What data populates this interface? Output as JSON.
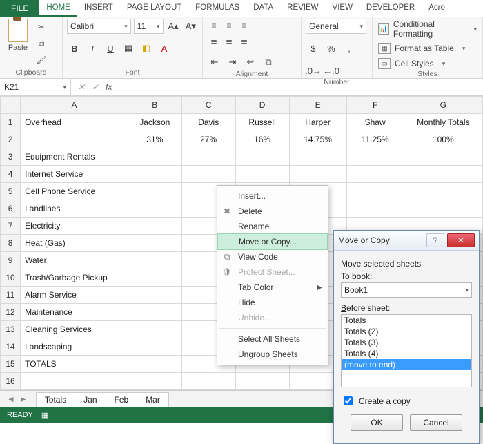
{
  "ribbon": {
    "file": "FILE",
    "tabs": [
      "HOME",
      "INSERT",
      "PAGE LAYOUT",
      "FORMULAS",
      "DATA",
      "REVIEW",
      "VIEW",
      "DEVELOPER",
      "Acro"
    ],
    "clipboard": {
      "paste": "Paste",
      "group": "Clipboard"
    },
    "font": {
      "name": "Calibri",
      "size": "11",
      "group": "Font"
    },
    "alignment": {
      "group": "Alignment"
    },
    "number": {
      "format": "General",
      "group": "Number"
    },
    "styles": {
      "cond": "Conditional Formatting",
      "table": "Format as Table",
      "cell": "Cell Styles",
      "group": "Styles"
    }
  },
  "formula_bar": {
    "name_box": "K21",
    "fx": "fx"
  },
  "columns": [
    "A",
    "B",
    "C",
    "D",
    "E",
    "F",
    "G"
  ],
  "headers": [
    "Overhead",
    "Jackson",
    "Davis",
    "Russell",
    "Harper",
    "Shaw",
    "Monthly Totals"
  ],
  "percent_row": [
    "",
    "31%",
    "27%",
    "16%",
    "14.75%",
    "11.25%",
    "100%"
  ],
  "items": [
    "Equipment Rentals",
    "Internet Service",
    "Cell Phone Service",
    "Landlines",
    "Electricity",
    "Heat (Gas)",
    "Water",
    "Trash/Garbage Pickup",
    "Alarm Service",
    "Maintenance",
    "Cleaning Services",
    "Landscaping"
  ],
  "totals_label": "TOTALS",
  "sheet_tabs": [
    "Totals",
    "Jan",
    "Feb",
    "Mar"
  ],
  "status": {
    "ready": "READY"
  },
  "context_menu": {
    "insert": "Insert...",
    "delete": "Delete",
    "rename": "Rename",
    "move_copy": "Move or Copy...",
    "view_code": "View Code",
    "protect": "Protect Sheet...",
    "tab_color": "Tab Color",
    "hide": "Hide",
    "unhide": "Unhide...",
    "select_all": "Select All Sheets",
    "ungroup": "Ungroup Sheets"
  },
  "dialog": {
    "title": "Move or Copy",
    "move_selected": "Move selected sheets",
    "to_book": "To book:",
    "book_value": "Book1",
    "before_sheet": "Before sheet:",
    "list": [
      "Totals",
      "Totals (2)",
      "Totals (3)",
      "Totals (4)",
      "(move to end)"
    ],
    "selected_index": 4,
    "create_copy": "Create a copy",
    "ok": "OK",
    "cancel": "Cancel"
  },
  "colwidths": {
    "row": 28,
    "A": 150,
    "B": 75,
    "C": 75,
    "D": 75,
    "E": 80,
    "F": 80,
    "G": 110
  }
}
